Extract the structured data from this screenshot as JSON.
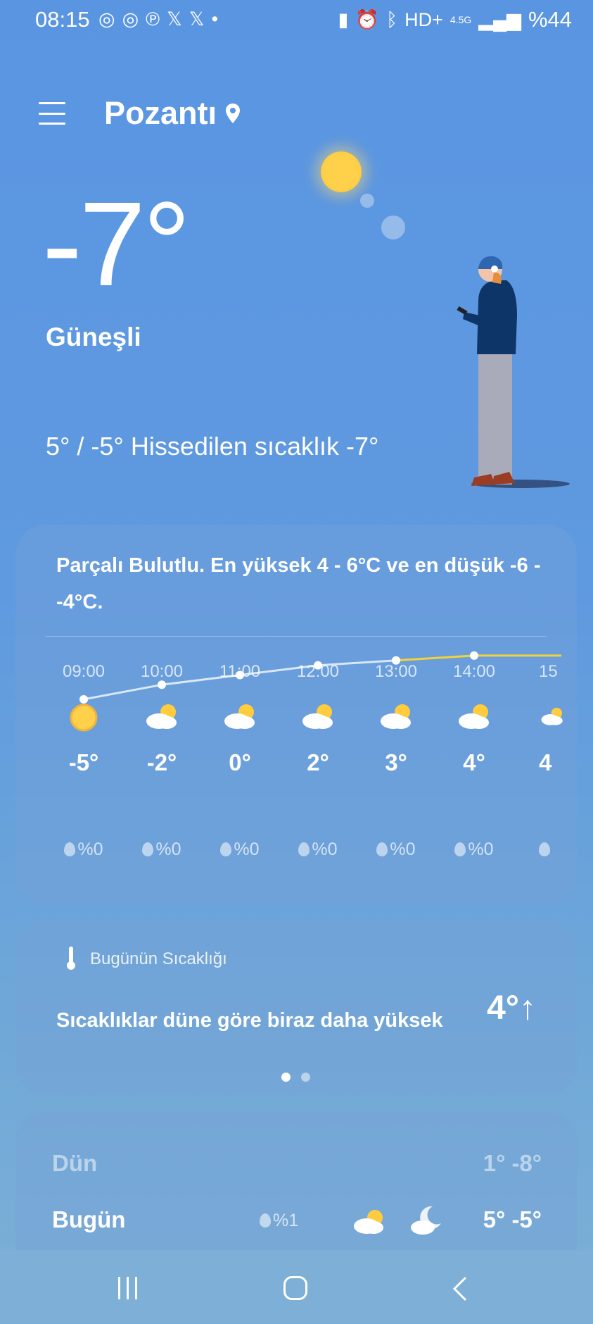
{
  "status_bar": {
    "time": "08:15",
    "left_icons": [
      "instagram-icon",
      "instagram-icon",
      "pinterest-icon",
      "x-icon",
      "x-icon",
      "dot"
    ],
    "right_icons": [
      "battery-saver-icon",
      "alarm-icon",
      "bluetooth-icon",
      "hd-plus-icon",
      "4.5g-icon",
      "signal-icon"
    ],
    "network": "4.5G",
    "hd_label": "HD+",
    "battery": "%44"
  },
  "header": {
    "location": "Pozantı"
  },
  "current": {
    "temperature": "-7°",
    "condition": "Güneşli",
    "high_low": "5° / -5°",
    "feels_like": "Hissedilen sıcaklık -7°"
  },
  "hourly_card": {
    "summary": "Parçalı Bulutlu. En yüksek 4 - 6°C ve en düşük -6 - -4°C.",
    "hours": [
      {
        "time": "09:00",
        "icon": "sun-icon",
        "temp": "-5°",
        "temp_value": -5,
        "precip": "%0"
      },
      {
        "time": "10:00",
        "icon": "partly-cloudy-icon",
        "temp": "-2°",
        "temp_value": -2,
        "precip": "%0"
      },
      {
        "time": "11:00",
        "icon": "partly-cloudy-icon",
        "temp": "0°",
        "temp_value": 0,
        "precip": "%0"
      },
      {
        "time": "12:00",
        "icon": "partly-cloudy-icon",
        "temp": "2°",
        "temp_value": 2,
        "precip": "%0"
      },
      {
        "time": "13:00",
        "icon": "partly-cloudy-icon",
        "temp": "3°",
        "temp_value": 3,
        "precip": "%0"
      },
      {
        "time": "14:00",
        "icon": "partly-cloudy-icon",
        "temp": "4°",
        "temp_value": 4,
        "precip": "%0"
      },
      {
        "time": "15",
        "icon": "partly-cloudy-icon",
        "temp": "4",
        "temp_value": 4,
        "precip": ""
      }
    ]
  },
  "today_temp_card": {
    "label": "Bugünün Sıcaklığı",
    "description": "Sıcaklıklar düne göre biraz daha yüksek",
    "delta": "4°↑",
    "page_count": 2,
    "active_page": 0
  },
  "daily": [
    {
      "name": "Dün",
      "precip": "",
      "range": "1° -8°"
    },
    {
      "name": "Bugün",
      "precip": "%1",
      "day_icon": "partly-cloudy-icon",
      "night_icon": "moon-cloud-icon",
      "range": "5° -5°"
    }
  ],
  "colors": {
    "background_top": "#5a95e2",
    "background_bottom": "#7cb0d6",
    "sun": "#ffd04a",
    "temp_line_warm": "#f2d23b"
  }
}
